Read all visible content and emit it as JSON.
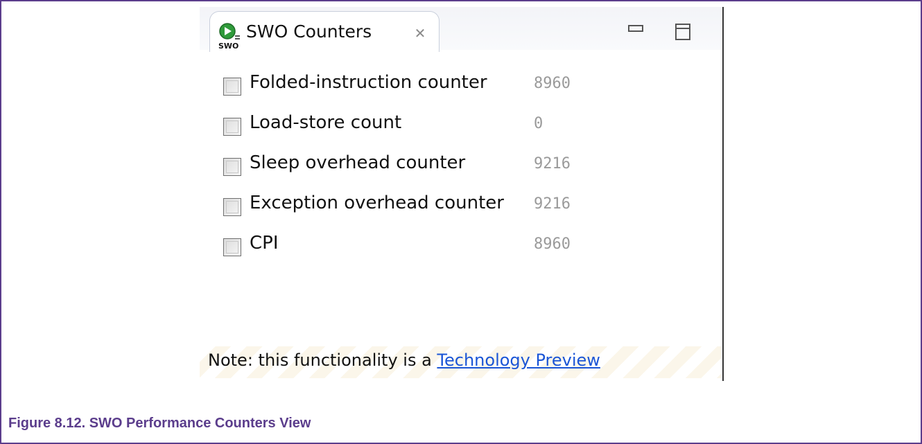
{
  "view": {
    "tab_title": "SWO Counters",
    "tab_icon": "swo-run-icon",
    "close_icon": "close-icon",
    "minimize_icon": "minimize-icon",
    "maximize_icon": "maximize-icon"
  },
  "counters": [
    {
      "label": "Folded-instruction counter",
      "value": "8960",
      "checked": false
    },
    {
      "label": "Load-store count",
      "value": "0",
      "checked": false
    },
    {
      "label": "Sleep overhead counter",
      "value": "9216",
      "checked": false
    },
    {
      "label": "Exception overhead counter",
      "value": "9216",
      "checked": false
    },
    {
      "label": "CPI",
      "value": "8960",
      "checked": false
    }
  ],
  "note": {
    "prefix": "Note: this functionality is a ",
    "link_text": "Technology Preview"
  },
  "caption": "Figure 8.12. SWO Performance Counters View",
  "colors": {
    "frame_border": "#5b3d8c",
    "caption": "#5b3d8c",
    "link": "#1a55d6",
    "value_text": "#9a9a9a"
  }
}
